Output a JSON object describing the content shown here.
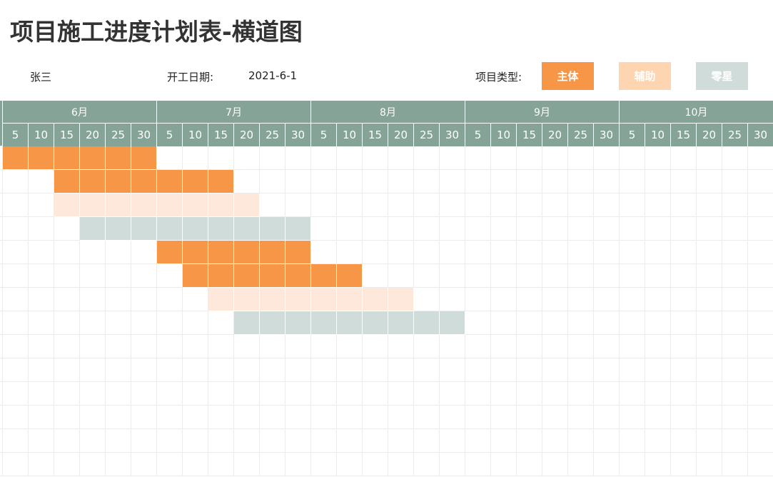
{
  "header": {
    "title": "项目施工进度计划表-横道图",
    "person": "张三",
    "start_date_label": "开工日期:",
    "start_date_value": "2021-6-1",
    "type_label": "项目类型:"
  },
  "legend": [
    {
      "label": "主体",
      "color": "#f79646",
      "key": "main"
    },
    {
      "label": "辅助",
      "color": "#fdd5b1",
      "key": "aux"
    },
    {
      "label": "零星",
      "color": "#d0dcd9",
      "key": "misc"
    }
  ],
  "colors": {
    "header_bg": "#86a398",
    "main": "#f79646",
    "aux": "#fde8db",
    "misc": "#d0dcd9"
  },
  "months": [
    "6月",
    "7月",
    "8月",
    "9月",
    "10月"
  ],
  "days": [
    "5",
    "10",
    "15",
    "20",
    "25",
    "30"
  ],
  "tasks": [
    {
      "type": "main",
      "start": 0,
      "span": 6
    },
    {
      "type": "main",
      "start": 2,
      "span": 7
    },
    {
      "type": "aux",
      "start": 2,
      "span": 8
    },
    {
      "type": "misc",
      "start": 3,
      "span": 9
    },
    {
      "type": "main",
      "start": 6,
      "span": 6
    },
    {
      "type": "main",
      "start": 7,
      "span": 7
    },
    {
      "type": "aux",
      "start": 8,
      "span": 8
    },
    {
      "type": "misc",
      "start": 9,
      "span": 9
    },
    {
      "type": "none",
      "start": 0,
      "span": 0
    },
    {
      "type": "none",
      "start": 0,
      "span": 0
    },
    {
      "type": "none",
      "start": 0,
      "span": 0
    },
    {
      "type": "none",
      "start": 0,
      "span": 0
    },
    {
      "type": "none",
      "start": 0,
      "span": 0
    },
    {
      "type": "none",
      "start": 0,
      "span": 0
    }
  ]
}
